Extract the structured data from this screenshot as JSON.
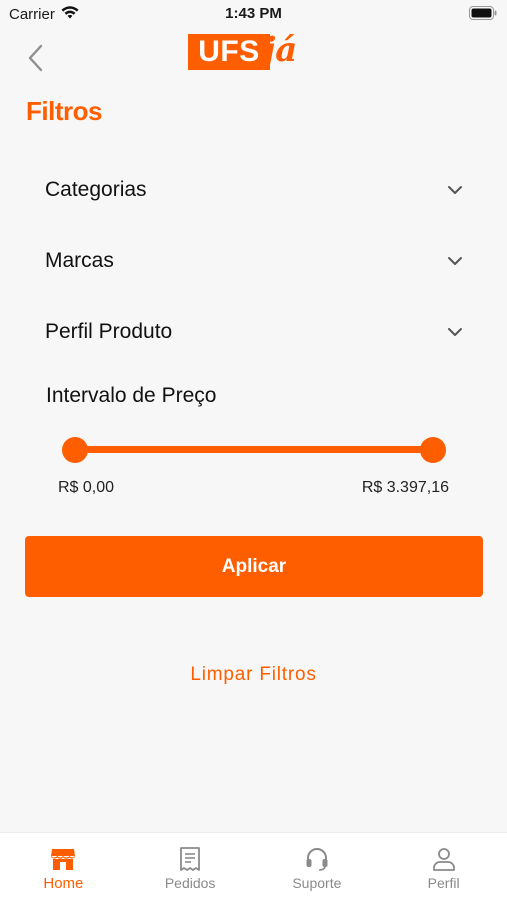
{
  "status_bar": {
    "carrier": "Carrier",
    "time": "1:43 PM"
  },
  "header": {
    "logo_primary": "UFS",
    "logo_secondary": "já"
  },
  "page": {
    "title": "Filtros"
  },
  "filters": [
    {
      "label": "Categorias"
    },
    {
      "label": "Marcas"
    },
    {
      "label": "Perfil Produto"
    }
  ],
  "price_range": {
    "title": "Intervalo de Preço",
    "min_label": "R$ 0,00",
    "max_label": "R$ 3.397,16",
    "selected_min": 0,
    "selected_max": 3397.16
  },
  "actions": {
    "apply_label": "Aplicar",
    "clear_label": "Limpar Filtros"
  },
  "tab_bar": {
    "active": "home",
    "items": [
      {
        "id": "home",
        "label": "Home",
        "icon": "store-icon"
      },
      {
        "id": "orders",
        "label": "Pedidos",
        "icon": "receipt-icon"
      },
      {
        "id": "support",
        "label": "Suporte",
        "icon": "headset-icon"
      },
      {
        "id": "profile",
        "label": "Perfil",
        "icon": "user-icon"
      }
    ]
  },
  "colors": {
    "accent": "#ff5e00",
    "inactive": "#8a8a8a",
    "background": "#f7f7f7"
  }
}
